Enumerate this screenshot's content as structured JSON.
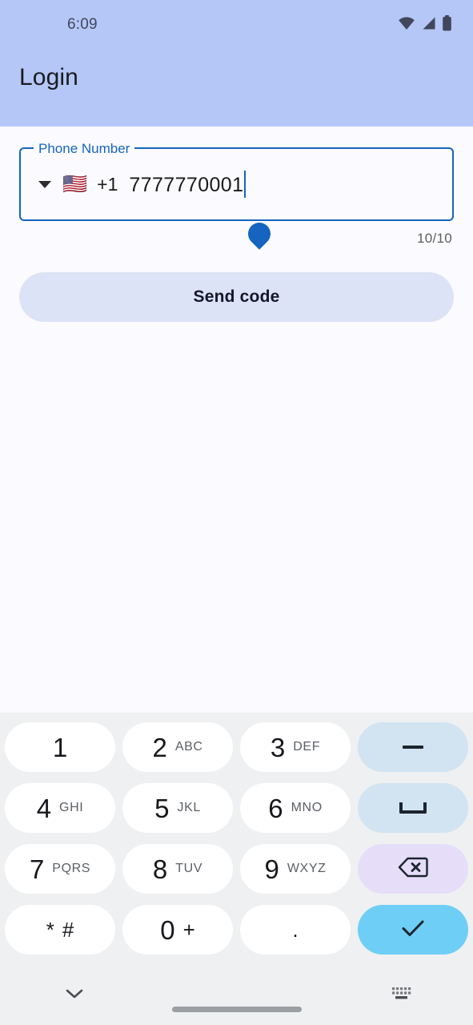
{
  "status_bar": {
    "time": "6:09",
    "icons": [
      "wifi-icon",
      "cellular-signal-icon",
      "battery-icon"
    ]
  },
  "app_bar": {
    "title": "Login",
    "background_color": "#b4c7f6"
  },
  "form": {
    "phone_field": {
      "label": "Phone Number",
      "country_flag": "🇺🇸",
      "dial_code": "+1",
      "value": "7777770001",
      "placeholder": "Phone Number",
      "accent_color": "#1565c0",
      "focused": true,
      "counter": "10/10"
    },
    "send_button": {
      "label": "Send code",
      "background_color": "#dde3f6",
      "text_color": "#141728"
    }
  },
  "keyboard": {
    "background_color": "#eef0f1",
    "rows": [
      [
        {
          "name": "key-1",
          "digit": "1",
          "letters": "",
          "style": "normal"
        },
        {
          "name": "key-2",
          "digit": "2",
          "letters": "ABC",
          "style": "normal"
        },
        {
          "name": "key-3",
          "digit": "3",
          "letters": "DEF",
          "style": "normal"
        },
        {
          "name": "key-dash",
          "glyph": "dash-icon",
          "style": "func-blue"
        }
      ],
      [
        {
          "name": "key-4",
          "digit": "4",
          "letters": "GHI",
          "style": "normal"
        },
        {
          "name": "key-5",
          "digit": "5",
          "letters": "JKL",
          "style": "normal"
        },
        {
          "name": "key-6",
          "digit": "6",
          "letters": "MNO",
          "style": "normal"
        },
        {
          "name": "key-space",
          "glyph": "space-icon",
          "style": "func-blue"
        }
      ],
      [
        {
          "name": "key-7",
          "digit": "7",
          "letters": "PQRS",
          "style": "normal"
        },
        {
          "name": "key-8",
          "digit": "8",
          "letters": "TUV",
          "style": "normal"
        },
        {
          "name": "key-9",
          "digit": "9",
          "letters": "WXYZ",
          "style": "normal"
        },
        {
          "name": "key-backspace",
          "glyph": "backspace-icon",
          "style": "func-lav"
        }
      ],
      [
        {
          "name": "key-star-hash",
          "digit": "*",
          "letters2": "#",
          "style": "normal"
        },
        {
          "name": "key-0",
          "digit": "0",
          "letters2": "+",
          "style": "normal"
        },
        {
          "name": "key-period",
          "digit": ".",
          "letters": "",
          "style": "normal"
        },
        {
          "name": "key-enter",
          "glyph": "checkmark-icon",
          "style": "func-go"
        }
      ]
    ],
    "key_colors": {
      "normal": "#ffffff",
      "func_blue": "#d2e4f1",
      "func_lavender": "#e6def9",
      "func_go": "#6ecef5"
    }
  },
  "nav_bar": {
    "hide_keyboard_icon": "chevron-down-icon",
    "keyboard_switch_icon": "keyboard-icon",
    "home_indicator": "home-indicator"
  }
}
